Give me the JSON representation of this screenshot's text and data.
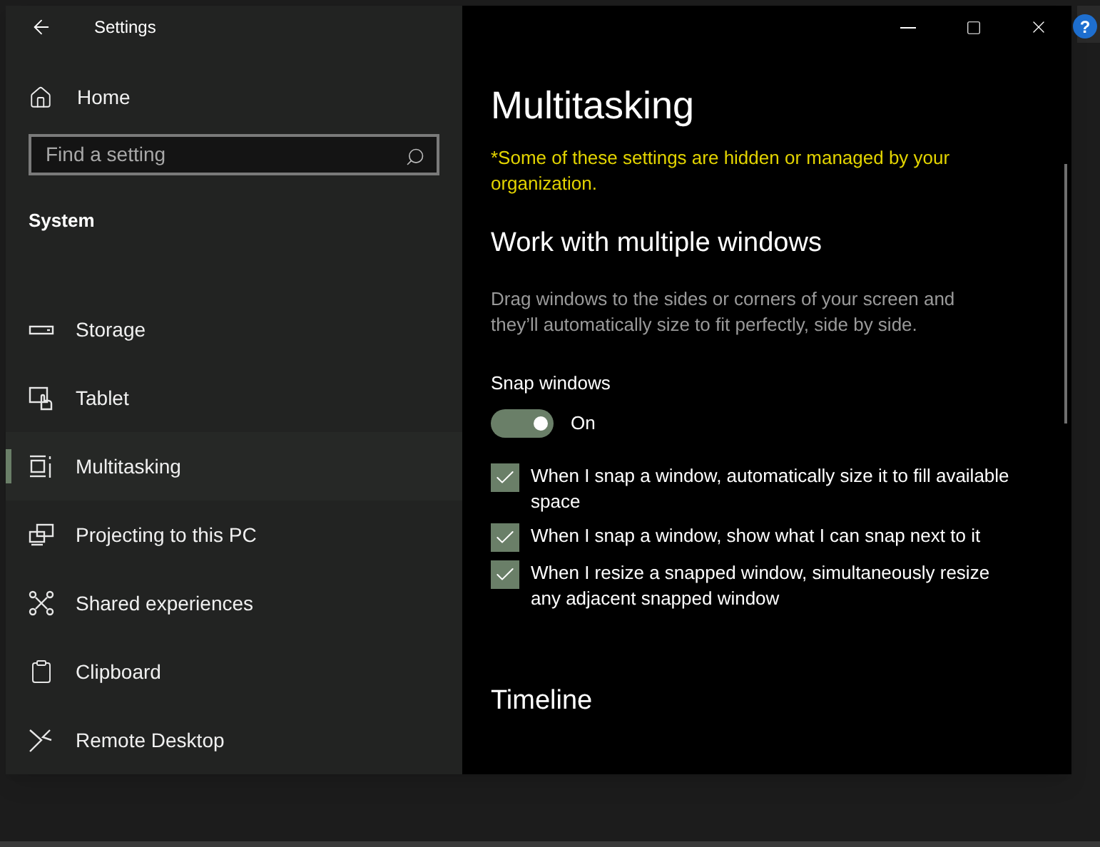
{
  "window": {
    "title": "Settings"
  },
  "help_badge": "?",
  "sidebar": {
    "home": "Home",
    "search": {
      "placeholder": "Find a setting"
    },
    "section": "System",
    "items": [
      {
        "label": "Storage",
        "kind": "storage",
        "selected": false
      },
      {
        "label": "Tablet",
        "kind": "tablet",
        "selected": false
      },
      {
        "label": "Multitasking",
        "kind": "multitasking",
        "selected": true
      },
      {
        "label": "Projecting to this PC",
        "kind": "projecting",
        "selected": false
      },
      {
        "label": "Shared experiences",
        "kind": "shared",
        "selected": false
      },
      {
        "label": "Clipboard",
        "kind": "clipboard",
        "selected": false
      },
      {
        "label": "Remote Desktop",
        "kind": "remote",
        "selected": false
      }
    ]
  },
  "content": {
    "title": "Multitasking",
    "notice": "*Some of these settings are hidden or managed by your organization.",
    "section": {
      "heading": "Work with multiple windows",
      "description": "Drag windows to the sides or corners of your screen and they’ll automatically size to fit perfectly, side by side.",
      "toggle": {
        "label": "Snap windows",
        "on": true,
        "state_text": "On"
      },
      "options": [
        {
          "label": "When I snap a window, automatically size it to fill available space",
          "checked": true
        },
        {
          "label": "When I snap a window, show what I can snap next to it",
          "checked": true
        },
        {
          "label": "When I resize a snapped window, simultaneously resize any adjacent snapped window",
          "checked": true
        }
      ]
    },
    "next_heading": "Timeline"
  }
}
